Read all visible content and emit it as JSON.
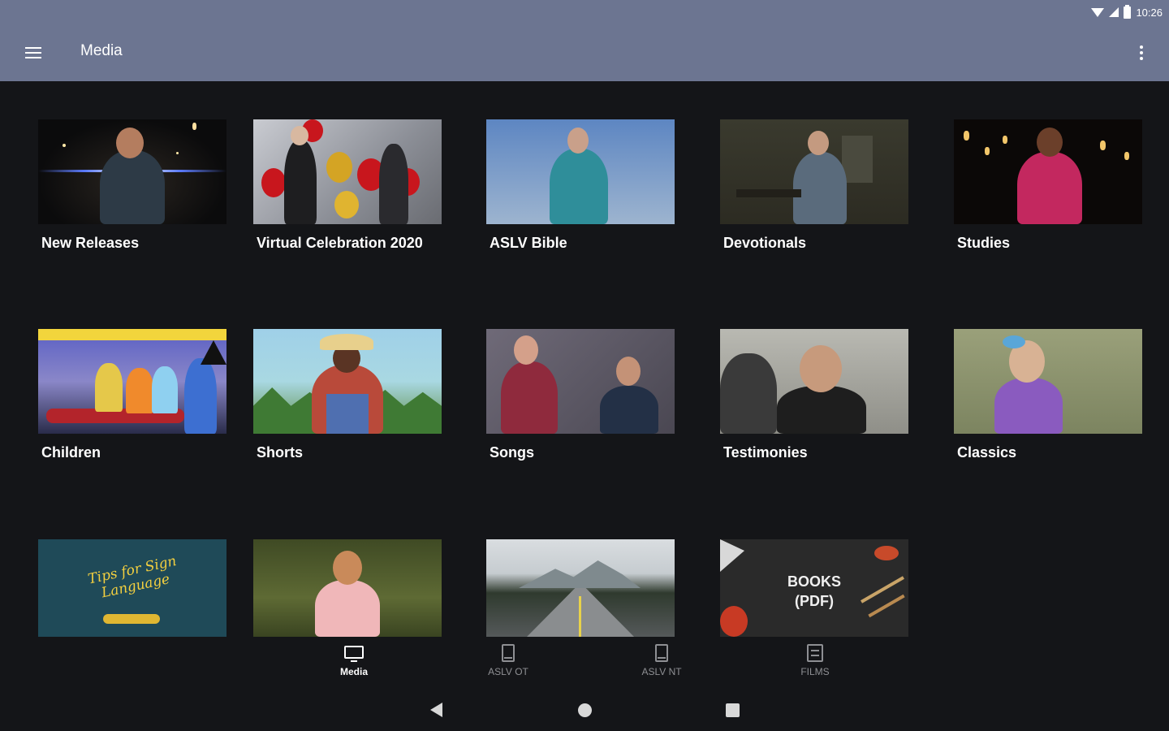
{
  "status_bar": {
    "time": "10:26"
  },
  "app_bar": {
    "title": "Media"
  },
  "tiles": [
    {
      "label": "New Releases"
    },
    {
      "label": "Virtual Celebration 2020"
    },
    {
      "label": "ASLV Bible"
    },
    {
      "label": "Devotionals"
    },
    {
      "label": "Studies"
    },
    {
      "label": "Children"
    },
    {
      "label": "Shorts"
    },
    {
      "label": "Songs"
    },
    {
      "label": "Testimonies"
    },
    {
      "label": "Classics"
    },
    {
      "label": "",
      "art_text": "Tips for Sign Language"
    },
    {
      "label": ""
    },
    {
      "label": ""
    },
    {
      "label": "",
      "art_text_line1": "BOOKS",
      "art_text_line2": "(PDF)"
    }
  ],
  "bottom_nav": {
    "items": [
      {
        "label": "Media",
        "icon": "tv-icon",
        "active": true
      },
      {
        "label": "ASLV OT",
        "icon": "book-icon",
        "active": false
      },
      {
        "label": "ASLV NT",
        "icon": "book-icon",
        "active": false
      },
      {
        "label": "FILMS",
        "icon": "film-icon",
        "active": false
      }
    ]
  },
  "colors": {
    "app_bar": "#6c7591",
    "background": "#141518",
    "inactive_nav": "#8e8f93"
  }
}
